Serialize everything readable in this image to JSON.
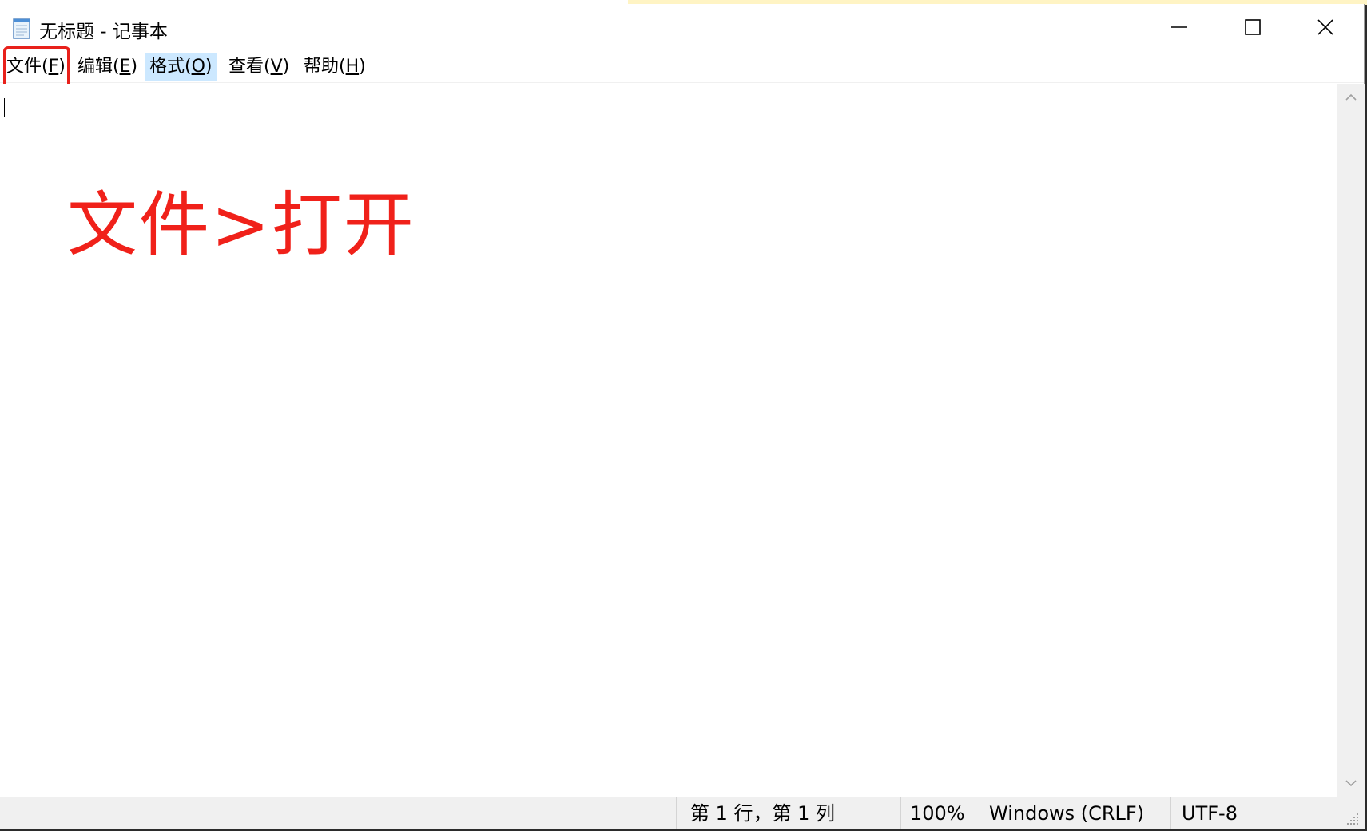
{
  "window": {
    "title": "无标题 - 记事本"
  },
  "menu": {
    "file": {
      "label": "文件(",
      "key": "F",
      "end": ")"
    },
    "edit": {
      "label": "编辑(",
      "key": "E",
      "end": ")"
    },
    "format": {
      "label": "格式(",
      "key": "O",
      "end": ")"
    },
    "view": {
      "label": "查看(",
      "key": "V",
      "end": ")"
    },
    "help": {
      "label": "帮助(",
      "key": "H",
      "end": ")"
    }
  },
  "annotation": {
    "text": "文件>打开",
    "color": "#f0211a"
  },
  "status": {
    "position": "第 1 行，第 1 列",
    "zoom": "100%",
    "line_ending": "Windows (CRLF)",
    "encoding": "UTF-8"
  },
  "icons": {
    "app": "notepad-icon",
    "minimize": "minimize-icon",
    "maximize": "maximize-icon",
    "close": "close-icon"
  },
  "colors": {
    "highlight": "#e8211b",
    "menu_hover": "#cce8ff"
  }
}
